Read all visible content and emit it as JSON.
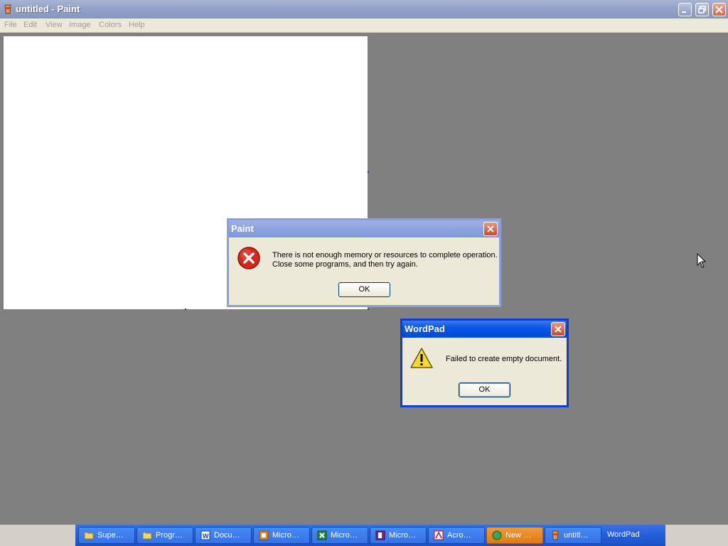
{
  "window": {
    "title": "untitled - Paint",
    "menu": [
      "File",
      "Edit",
      "View",
      "Image",
      "Colors",
      "Help"
    ]
  },
  "paint_dialog": {
    "title": "Paint",
    "message_line1": "There is not enough memory or resources to complete operation.",
    "message_line2": "Close some programs, and then try again.",
    "ok_label": "OK",
    "icon": "error-icon"
  },
  "wordpad_dialog": {
    "title": "WordPad",
    "message": "Failed to create empty document.",
    "ok_label": "OK",
    "icon": "warning-icon"
  },
  "taskbar": {
    "items": [
      {
        "label": "Supe…",
        "icon": "folder-icon"
      },
      {
        "label": "Progr…",
        "icon": "folder-icon"
      },
      {
        "label": "Docu…",
        "icon": "word-icon"
      },
      {
        "label": "Micro…",
        "icon": "powerpoint-icon"
      },
      {
        "label": "Micro…",
        "icon": "excel-icon"
      },
      {
        "label": "Micro…",
        "icon": "publisher-icon"
      },
      {
        "label": "Acro…",
        "icon": "acrobat-icon"
      },
      {
        "label": "New …",
        "icon": "messenger-icon"
      },
      {
        "label": "untitl…",
        "icon": "paint-icon"
      },
      {
        "label": "WordPad",
        "icon": ""
      }
    ]
  },
  "colors": {
    "desktop_bg": "#808080",
    "active_title": "#0a57e8",
    "taskbar_active": "#e07a14"
  }
}
